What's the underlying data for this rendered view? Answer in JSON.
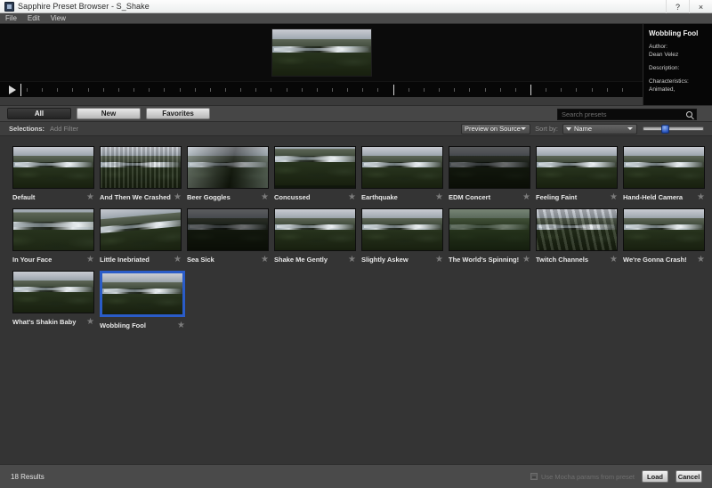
{
  "window": {
    "title": "Sapphire Preset Browser - S_Shake",
    "icon": "app-icon",
    "help_label": "?",
    "close_label": "×"
  },
  "menubar": {
    "items": [
      {
        "label": "File"
      },
      {
        "label": "Edit"
      },
      {
        "label": "View"
      }
    ]
  },
  "preview": {
    "play_label": "▶"
  },
  "info_panel": {
    "title": "Wobbling Fool",
    "author_key": "Author:",
    "author_value": "Dean Velez",
    "description_key": "Description:",
    "description_value": "",
    "characteristics_key": "Characteristics:",
    "characteristics_value": "Animated,"
  },
  "tabs": [
    {
      "label": "All",
      "active": true
    },
    {
      "label": "New",
      "active": false
    },
    {
      "label": "Favorites",
      "active": false
    }
  ],
  "search": {
    "placeholder": "Search presets",
    "value": "",
    "icon": "search-icon"
  },
  "filterbar": {
    "selections_label": "Selections:",
    "add_filter_label": "Add Filter",
    "preview_mode": "Preview on Source",
    "sort_by_label": "Sort by:",
    "sort_value": "Name",
    "slider_position_percent": 30
  },
  "colors": {
    "selection_blue": "#2a5cc8",
    "panel_dark": "#343434",
    "chrome": "#4a4a4a",
    "stage_black": "#0b0b0b"
  },
  "grid": {
    "star_glyph": "★",
    "items": [
      {
        "label": "Default",
        "fx": "fx-none",
        "selected": false
      },
      {
        "label": "And Then We Crashed",
        "fx": "fx-blurv",
        "selected": false
      },
      {
        "label": "Beer Goggles",
        "fx": "fx-smear",
        "selected": false
      },
      {
        "label": "Concussed",
        "fx": "fx-shift",
        "selected": false
      },
      {
        "label": "Earthquake",
        "fx": "fx-none",
        "selected": false
      },
      {
        "label": "EDM Concert",
        "fx": "fx-dark",
        "selected": false
      },
      {
        "label": "Feeling Faint",
        "fx": "fx-none",
        "selected": false
      },
      {
        "label": "Hand-Held Camera",
        "fx": "fx-none",
        "selected": false
      },
      {
        "label": "In Your Face",
        "fx": "fx-zoom",
        "selected": false
      },
      {
        "label": "Little Inebriated",
        "fx": "fx-tilt",
        "selected": false
      },
      {
        "label": "Sea Sick",
        "fx": "fx-dark",
        "selected": false
      },
      {
        "label": "Shake Me Gently",
        "fx": "fx-none",
        "selected": false
      },
      {
        "label": "Slightly Askew",
        "fx": "fx-none",
        "selected": false
      },
      {
        "label": "The World's Spinning!",
        "fx": "fx-green",
        "selected": false
      },
      {
        "label": "Twitch Channels",
        "fx": "fx-streak",
        "selected": false
      },
      {
        "label": "We're Gonna Crash!",
        "fx": "fx-none",
        "selected": false
      },
      {
        "label": "What's Shakin Baby",
        "fx": "fx-none",
        "selected": false
      },
      {
        "label": "Wobbling Fool",
        "fx": "fx-none",
        "selected": true
      }
    ]
  },
  "statusbar": {
    "results": "18 Results",
    "mocha_label": "Use Mocha params from preset",
    "mocha_checked": false,
    "load_label": "Load",
    "cancel_label": "Cancel"
  }
}
